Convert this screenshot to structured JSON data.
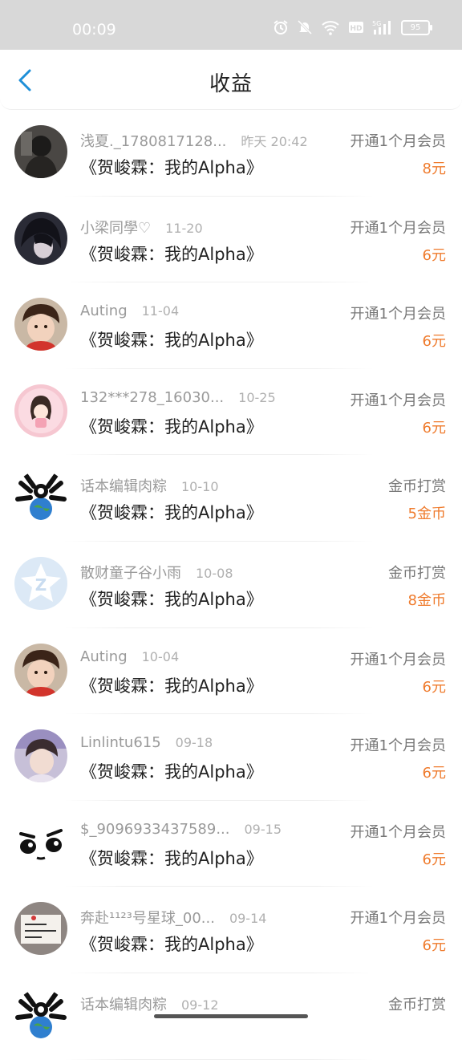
{
  "status_bar": {
    "time": "00:09",
    "battery": "95"
  },
  "header": {
    "title": "收益"
  },
  "colors": {
    "accent": "#1e8fd8",
    "amount": "#ef7b2d"
  },
  "rows": [
    {
      "name": "浅夏._1780817128...",
      "date": "昨天 20:42",
      "book": "《贺峻霖：我的Alpha》",
      "type": "开通1个月会员",
      "amount": "8元",
      "avatar": "dark-figure"
    },
    {
      "name": "小梁同學♡",
      "date": "11-20",
      "book": "《贺峻霖：我的Alpha》",
      "type": "开通1个月会员",
      "amount": "6元",
      "avatar": "dark-hair"
    },
    {
      "name": "Auting",
      "date": "11-04",
      "book": "《贺峻霖：我的Alpha》",
      "type": "开通1个月会员",
      "amount": "6元",
      "avatar": "child"
    },
    {
      "name": "132***278_16030...",
      "date": "10-25",
      "book": "《贺峻霖：我的Alpha》",
      "type": "开通1个月会员",
      "amount": "6元",
      "avatar": "cartoon-girl"
    },
    {
      "name": "话本编辑肉粽",
      "date": "10-10",
      "book": "《贺峻霖：我的Alpha》",
      "type": "金币打赏",
      "amount": "5金币",
      "avatar": "doodle"
    },
    {
      "name": "散财童子谷小雨",
      "date": "10-08",
      "book": "《贺峻霖：我的Alpha》",
      "type": "金币打赏",
      "amount": "8金币",
      "avatar": "star-logo"
    },
    {
      "name": "Auting",
      "date": "10-04",
      "book": "《贺峻霖：我的Alpha》",
      "type": "开通1个月会员",
      "amount": "6元",
      "avatar": "child"
    },
    {
      "name": "Linlintu615",
      "date": "09-18",
      "book": "《贺峻霖：我的Alpha》",
      "type": "开通1个月会员",
      "amount": "6元",
      "avatar": "boy"
    },
    {
      "name": "$_9096933437589...",
      "date": "09-15",
      "book": "《贺峻霖：我的Alpha》",
      "type": "开通1个月会员",
      "amount": "6元",
      "avatar": "eyes"
    },
    {
      "name": "奔赴¹¹²³号星球_00...",
      "date": "09-14",
      "book": "《贺峻霖：我的Alpha》",
      "type": "开通1个月会员",
      "amount": "6元",
      "avatar": "note"
    },
    {
      "name": "话本编辑肉粽",
      "date": "09-12",
      "book": "",
      "type": "金币打赏",
      "amount": "",
      "avatar": "doodle"
    }
  ]
}
